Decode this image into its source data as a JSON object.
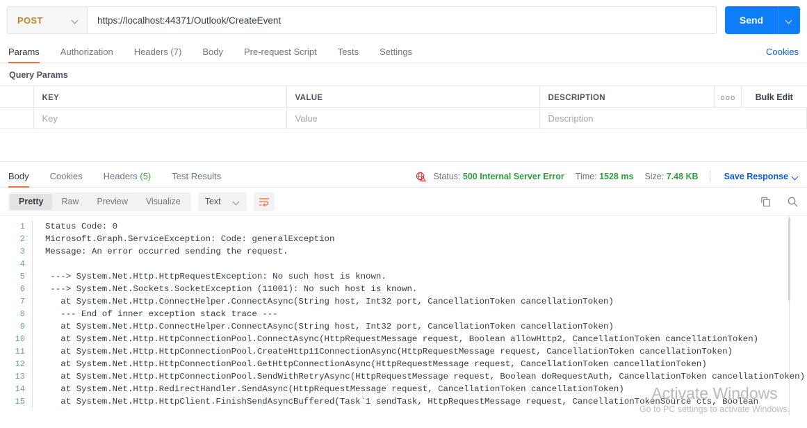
{
  "request": {
    "method": "POST",
    "url": "https://localhost:44371/Outlook/CreateEvent",
    "send_label": "Send",
    "tabs": [
      {
        "label": "Params",
        "active": true
      },
      {
        "label": "Authorization",
        "active": false
      },
      {
        "label": "Headers (7)",
        "active": false
      },
      {
        "label": "Body",
        "active": false
      },
      {
        "label": "Pre-request Script",
        "active": false
      },
      {
        "label": "Tests",
        "active": false
      },
      {
        "label": "Settings",
        "active": false
      }
    ],
    "cookies_link": "Cookies"
  },
  "query_params": {
    "section_title": "Query Params",
    "headers": {
      "key": "KEY",
      "value": "VALUE",
      "description": "DESCRIPTION",
      "more": "ooo",
      "bulk_edit": "Bulk Edit"
    },
    "rows": [
      {
        "key_placeholder": "Key",
        "value_placeholder": "Value",
        "description_placeholder": "Description"
      }
    ]
  },
  "response": {
    "tabs": [
      {
        "label": "Body",
        "count": "",
        "active": true
      },
      {
        "label": "Cookies",
        "count": "",
        "active": false
      },
      {
        "label": "Headers",
        "count": "(5)",
        "active": false
      },
      {
        "label": "Test Results",
        "count": "",
        "active": false
      }
    ],
    "meta": {
      "status_label": "Status:",
      "status_value": "500 Internal Server Error",
      "time_label": "Time:",
      "time_value": "1528 ms",
      "size_label": "Size:",
      "size_value": "7.48 KB",
      "save_response": "Save Response"
    },
    "view_modes": [
      {
        "label": "Pretty",
        "active": true
      },
      {
        "label": "Raw",
        "active": false
      },
      {
        "label": "Preview",
        "active": false
      },
      {
        "label": "Visualize",
        "active": false
      }
    ],
    "format": "Text",
    "body_lines": [
      "Status Code: 0",
      "Microsoft.Graph.ServiceException: Code: generalException",
      "Message: An error occurred sending the request.",
      "",
      " ---> System.Net.Http.HttpRequestException: No such host is known.",
      " ---> System.Net.Sockets.SocketException (11001): No such host is known.",
      "   at System.Net.Http.ConnectHelper.ConnectAsync(String host, Int32 port, CancellationToken cancellationToken)",
      "   --- End of inner exception stack trace ---",
      "   at System.Net.Http.ConnectHelper.ConnectAsync(String host, Int32 port, CancellationToken cancellationToken)",
      "   at System.Net.Http.HttpConnectionPool.ConnectAsync(HttpRequestMessage request, Boolean allowHttp2, CancellationToken cancellationToken)",
      "   at System.Net.Http.HttpConnectionPool.CreateHttp11ConnectionAsync(HttpRequestMessage request, CancellationToken cancellationToken)",
      "   at System.Net.Http.HttpConnectionPool.GetHttpConnectionAsync(HttpRequestMessage request, CancellationToken cancellationToken)",
      "   at System.Net.Http.HttpConnectionPool.SendWithRetryAsync(HttpRequestMessage request, Boolean doRequestAuth, CancellationToken cancellationToken)",
      "   at System.Net.Http.RedirectHandler.SendAsync(HttpRequestMessage request, CancellationToken cancellationToken)",
      "   at System.Net.Http.HttpClient.FinishSendAsyncBuffered(Task`1 sendTask, HttpRequestMessage request, CancellationTokenSource cts, Boolean"
    ]
  },
  "watermark": {
    "title": "Activate Windows",
    "subtitle": "Go to PC settings to activate Windows."
  },
  "colors": {
    "accent_orange": "#ff6c37",
    "send_blue": "#0d7ef7",
    "link_blue": "#0d5bd1",
    "status_green": "#2ea043",
    "method_orange": "#c0872a",
    "warning_red": "#e03131"
  }
}
